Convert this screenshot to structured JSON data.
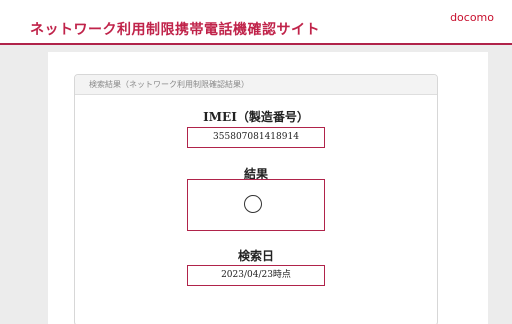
{
  "header": {
    "title": "ネットワーク利用制限携帯電話機確認サイト",
    "brand": "docomo"
  },
  "card": {
    "title": "検索結果（ネットワーク利用制限確認結果）",
    "imei_label": "IMEI（製造番号）",
    "imei_value": "355807081418914",
    "result_label": "結果",
    "result_symbol": "circle-mark",
    "date_label": "検索日",
    "date_value": "2023/04/23時点"
  }
}
